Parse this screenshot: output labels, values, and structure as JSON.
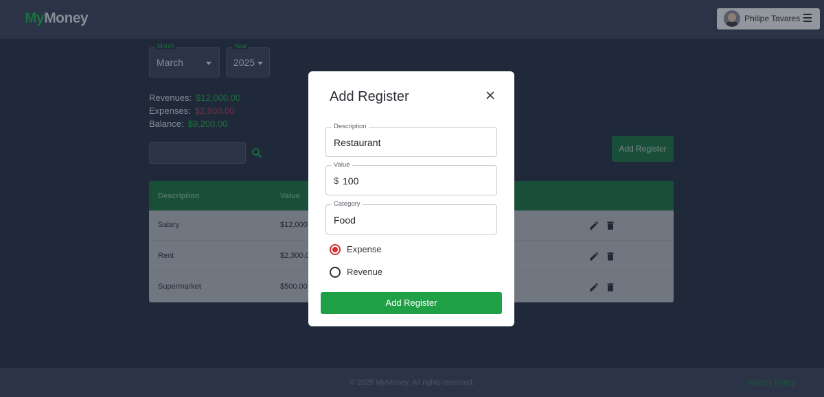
{
  "header": {
    "logo_part1": "My",
    "logo_part2": "Money",
    "user_name": "Philipe Tavares"
  },
  "filters": {
    "month_label": "Month",
    "month_value": "March",
    "year_label": "Year",
    "year_value": "2025"
  },
  "summary": {
    "revenues_label": "Revenues:",
    "revenues_value": "$12,000.00",
    "expenses_label": "Expenses:",
    "expenses_value": "$2,800.00",
    "balance_label": "Balance:",
    "balance_value": "$9,200.00"
  },
  "toolbar": {
    "add_register_label": "Add Register"
  },
  "table": {
    "headers": [
      "Description",
      "Value"
    ],
    "rows": [
      {
        "description": "Salary",
        "value": "$12,000"
      },
      {
        "description": "Rent",
        "value": "$2,300.0"
      },
      {
        "description": "Supermarket",
        "value": "$500.00"
      }
    ]
  },
  "footer": {
    "copyright": "© 2025 MyMoney. All rights reserved.",
    "privacy": "Privacy Policy"
  },
  "modal": {
    "title": "Add Register",
    "description_label": "Description",
    "description_value": "Restaurant",
    "value_label": "Value",
    "value_prefix": "$",
    "value_value": "100",
    "category_label": "Category",
    "category_value": "Food",
    "radio_expense": "Expense",
    "radio_revenue": "Revenue",
    "selected_type": "Expense",
    "submit_label": "Add Register"
  },
  "colors": {
    "brand_green": "#1fa046",
    "expense_red": "#d32f2f",
    "background": "#2a3448"
  }
}
